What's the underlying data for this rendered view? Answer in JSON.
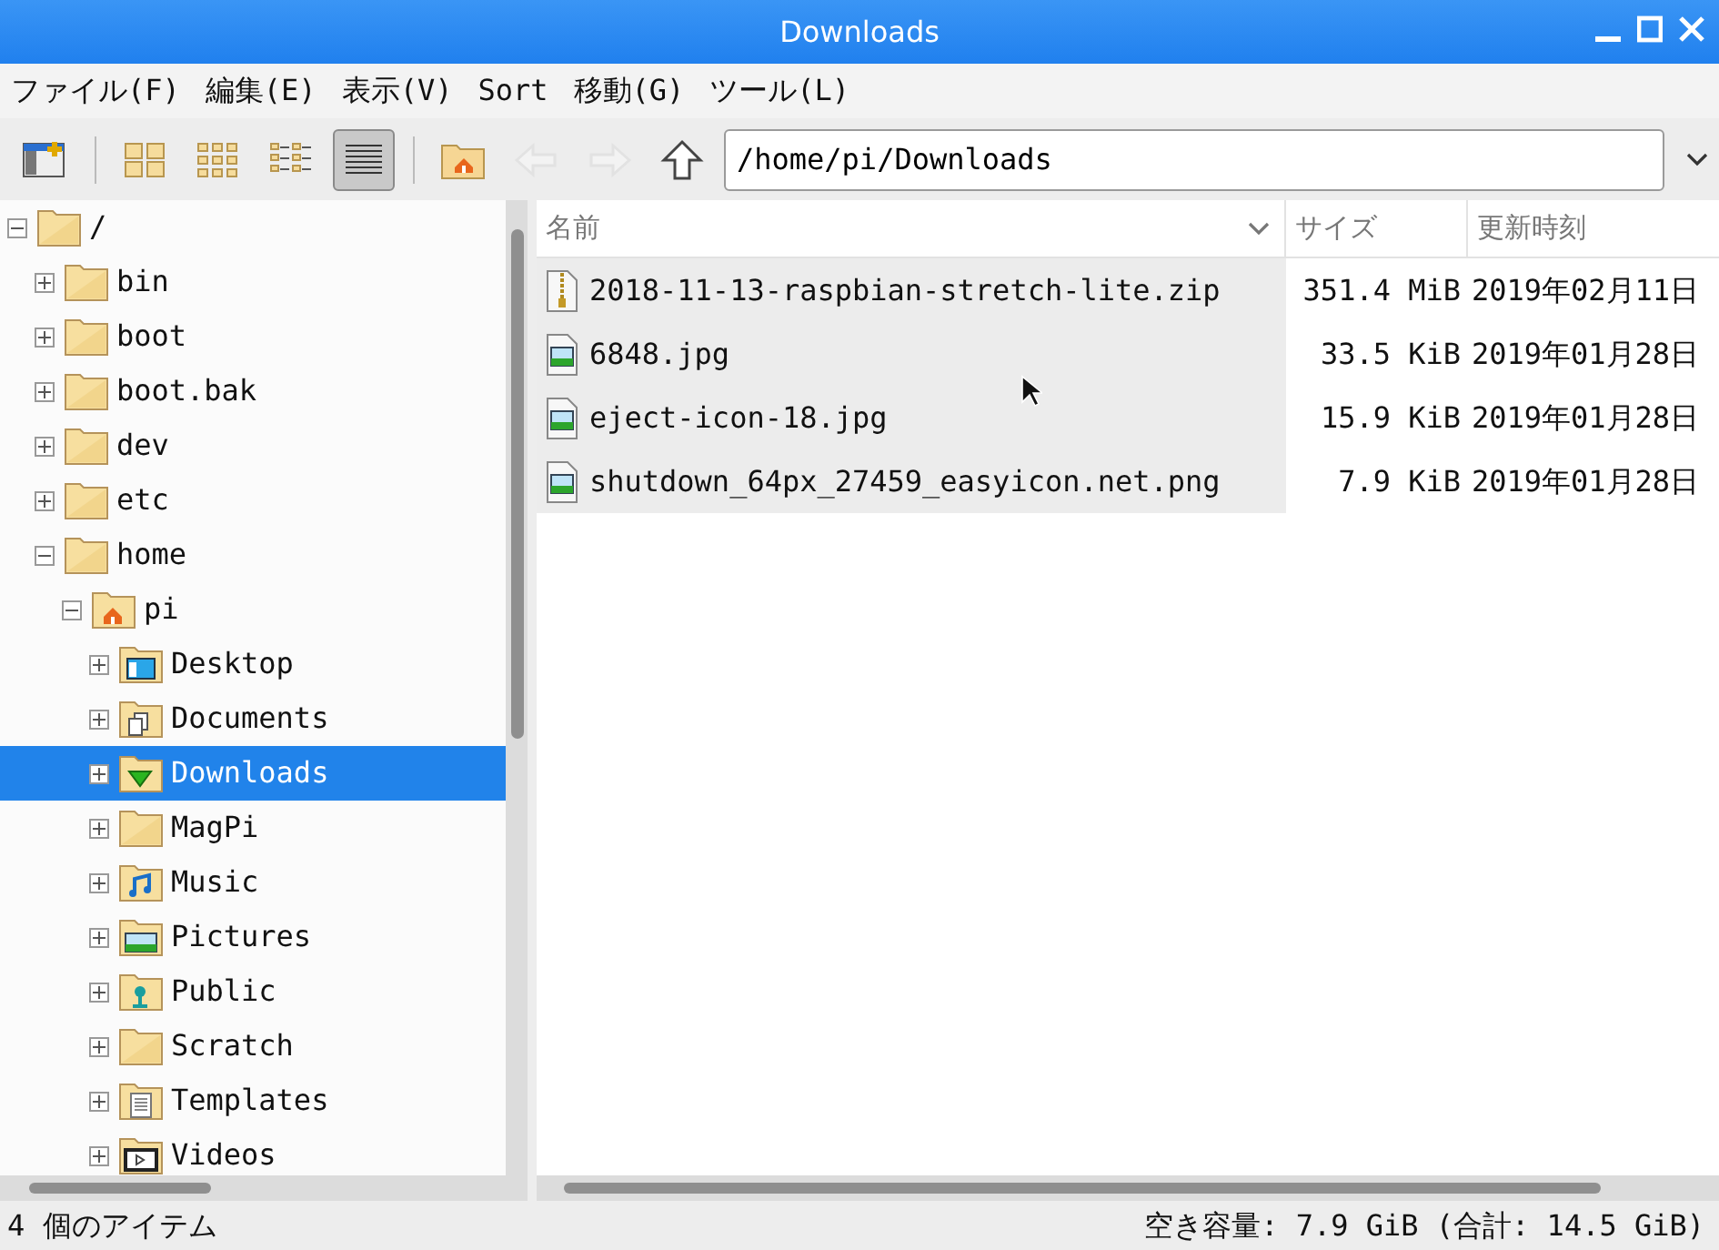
{
  "window": {
    "title": "Downloads"
  },
  "menu": [
    "ファイル(F)",
    "編集(E)",
    "表示(V)",
    "Sort",
    "移動(G)",
    "ツール(L)"
  ],
  "toolbar": {
    "view_modes": [
      {
        "kind": "icons",
        "selected": false
      },
      {
        "kind": "thumbnails",
        "selected": false
      },
      {
        "kind": "compact",
        "selected": false
      },
      {
        "kind": "details",
        "selected": true
      }
    ],
    "nav": [
      {
        "kind": "home",
        "disabled": false
      },
      {
        "kind": "back",
        "disabled": true
      },
      {
        "kind": "forward",
        "disabled": true
      },
      {
        "kind": "up",
        "disabled": false
      }
    ],
    "path": "/home/pi/Downloads"
  },
  "tree": [
    {
      "label": "/",
      "kind": "plain",
      "expanded": true,
      "selected": false,
      "children": [
        {
          "label": "bin",
          "kind": "plain",
          "expanded": false,
          "selected": false
        },
        {
          "label": "boot",
          "kind": "plain",
          "expanded": false,
          "selected": false
        },
        {
          "label": "boot.bak",
          "kind": "plain",
          "expanded": false,
          "selected": false
        },
        {
          "label": "dev",
          "kind": "plain",
          "expanded": false,
          "selected": false
        },
        {
          "label": "etc",
          "kind": "plain",
          "expanded": false,
          "selected": false
        },
        {
          "label": "home",
          "kind": "plain",
          "expanded": true,
          "selected": false,
          "children": [
            {
              "label": "pi",
              "kind": "home",
              "expanded": true,
              "selected": false,
              "children": [
                {
                  "label": "Desktop",
                  "kind": "desktop",
                  "expanded": false,
                  "selected": false
                },
                {
                  "label": "Documents",
                  "kind": "documents",
                  "expanded": false,
                  "selected": false
                },
                {
                  "label": "Downloads",
                  "kind": "download",
                  "expanded": false,
                  "selected": true
                },
                {
                  "label": "MagPi",
                  "kind": "plain",
                  "expanded": false,
                  "selected": false
                },
                {
                  "label": "Music",
                  "kind": "music",
                  "expanded": false,
                  "selected": false
                },
                {
                  "label": "Pictures",
                  "kind": "pictures",
                  "expanded": false,
                  "selected": false
                },
                {
                  "label": "Public",
                  "kind": "public",
                  "expanded": false,
                  "selected": false
                },
                {
                  "label": "Scratch",
                  "kind": "plain",
                  "expanded": false,
                  "selected": false
                },
                {
                  "label": "Templates",
                  "kind": "templates",
                  "expanded": false,
                  "selected": false
                },
                {
                  "label": "Videos",
                  "kind": "videos",
                  "expanded": false,
                  "selected": false
                }
              ]
            }
          ]
        }
      ]
    }
  ],
  "table": {
    "columns": [
      "名前",
      "サイズ",
      "更新時刻"
    ],
    "rows": [
      {
        "kind": "archive",
        "name": "2018-11-13-raspbian-stretch-lite.zip",
        "size": "351.4 MiB",
        "modified": "2019年02月11日"
      },
      {
        "kind": "image",
        "name": "6848.jpg",
        "size": "33.5 KiB",
        "modified": "2019年01月28日"
      },
      {
        "kind": "image",
        "name": "eject-icon-18.jpg",
        "size": "15.9 KiB",
        "modified": "2019年01月28日"
      },
      {
        "kind": "image",
        "name": "shutdown_64px_27459_easyicon.net.png",
        "size": "7.9 KiB",
        "modified": "2019年01月28日"
      }
    ]
  },
  "status_bar": {
    "items": "4 個のアイテム",
    "free_space": "空き容量: 7.9 GiB (合計: 14.5 GiB)"
  }
}
